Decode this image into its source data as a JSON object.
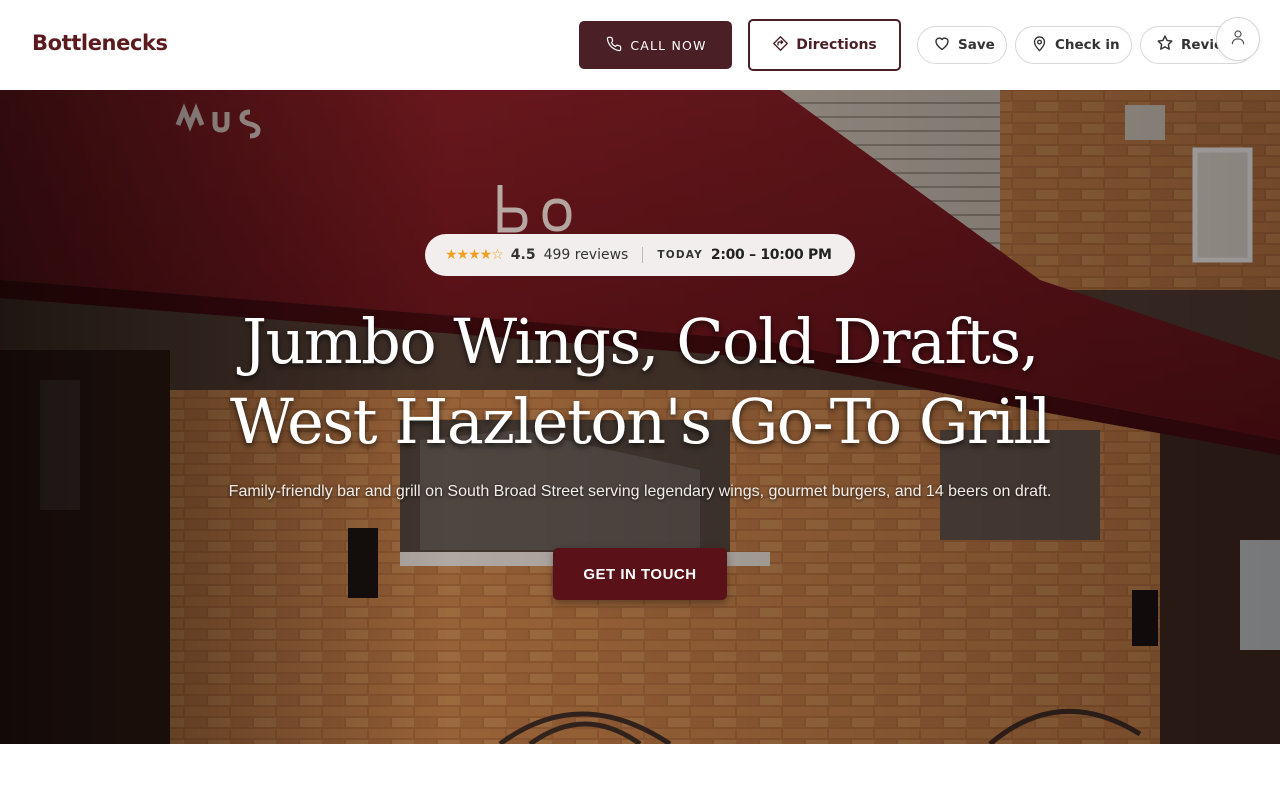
{
  "header": {
    "logo": "Bottlenecks",
    "call_label": "CALL NOW",
    "directions_label": "Directions",
    "save_label": "Save",
    "checkin_label": "Check in",
    "review_label": "Review"
  },
  "hero": {
    "stars": "★★★★☆",
    "rating": "4.5",
    "reviews": "499 reviews",
    "today_label": "TODAY",
    "hours": "2:00 – 10:00 PM",
    "headline_line1": "Jumbo Wings, Cold Drafts,",
    "headline_line2": "West Hazleton's Go-To Grill",
    "subtitle": "Family-friendly bar and grill on South Broad Street serving legendary wings, gourmet burgers, and 14 beers on draft.",
    "cta_label": "GET IN TOUCH",
    "rating_value": 4.5
  },
  "colors": {
    "brand": "#5a1a1e",
    "button_dark": "#4a1f26",
    "cta": "#5a1218",
    "star": "#f0a020"
  },
  "icons": [
    "phone-icon",
    "directions-icon",
    "heart-icon",
    "location-pin-icon",
    "star-outline-icon",
    "user-icon"
  ]
}
